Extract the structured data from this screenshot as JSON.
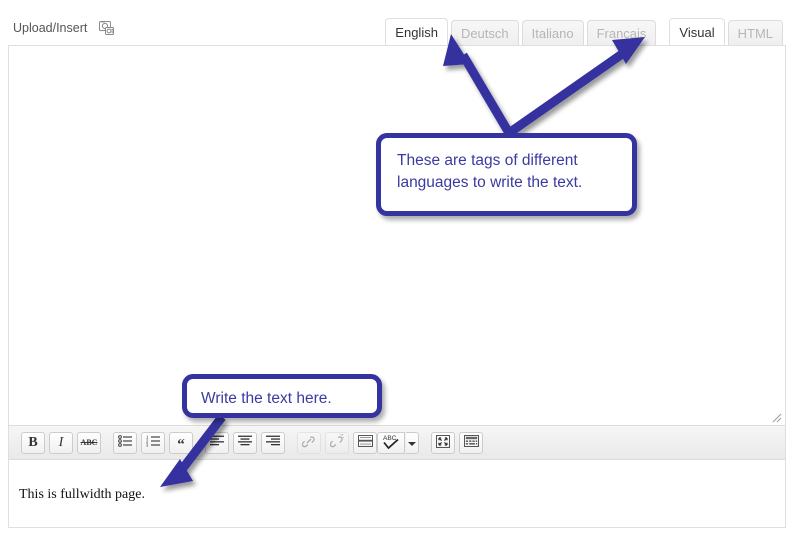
{
  "topbar": {
    "upload_insert_label": "Upload/Insert",
    "media_icon": "add-media-icon"
  },
  "tabs": {
    "language_tabs": [
      {
        "label": "English",
        "active": true
      },
      {
        "label": "Deutsch",
        "active": false
      },
      {
        "label": "Italiano",
        "active": false
      },
      {
        "label": "Français",
        "active": false
      }
    ],
    "mode_tabs": [
      {
        "label": "Visual",
        "active": true
      },
      {
        "label": "HTML",
        "active": false
      }
    ]
  },
  "toolbar": {
    "buttons": [
      {
        "name": "bold",
        "glyph": "B"
      },
      {
        "name": "italic",
        "glyph": "I"
      },
      {
        "name": "strikethrough",
        "glyph": "ABC"
      },
      {
        "name": "bulleted-list",
        "glyph": ""
      },
      {
        "name": "numbered-list",
        "glyph": ""
      },
      {
        "name": "blockquote",
        "glyph": "“"
      },
      {
        "name": "align-left",
        "glyph": ""
      },
      {
        "name": "align-center",
        "glyph": ""
      },
      {
        "name": "align-right",
        "glyph": ""
      },
      {
        "name": "insert-link",
        "glyph": ""
      },
      {
        "name": "unlink",
        "glyph": ""
      },
      {
        "name": "insert-more-tag",
        "glyph": ""
      },
      {
        "name": "spellcheck",
        "glyph": "ABC"
      },
      {
        "name": "fullscreen",
        "glyph": ""
      },
      {
        "name": "kitchen-sink",
        "glyph": ""
      }
    ]
  },
  "editor": {
    "body_text": "This is fullwidth page.",
    "resize_handle": "resize-grip"
  },
  "annotations": {
    "languages_note": "These are tags of different languages to write the text.",
    "write_here_note": "Write the text here.",
    "accent_color": "#3533a0"
  }
}
